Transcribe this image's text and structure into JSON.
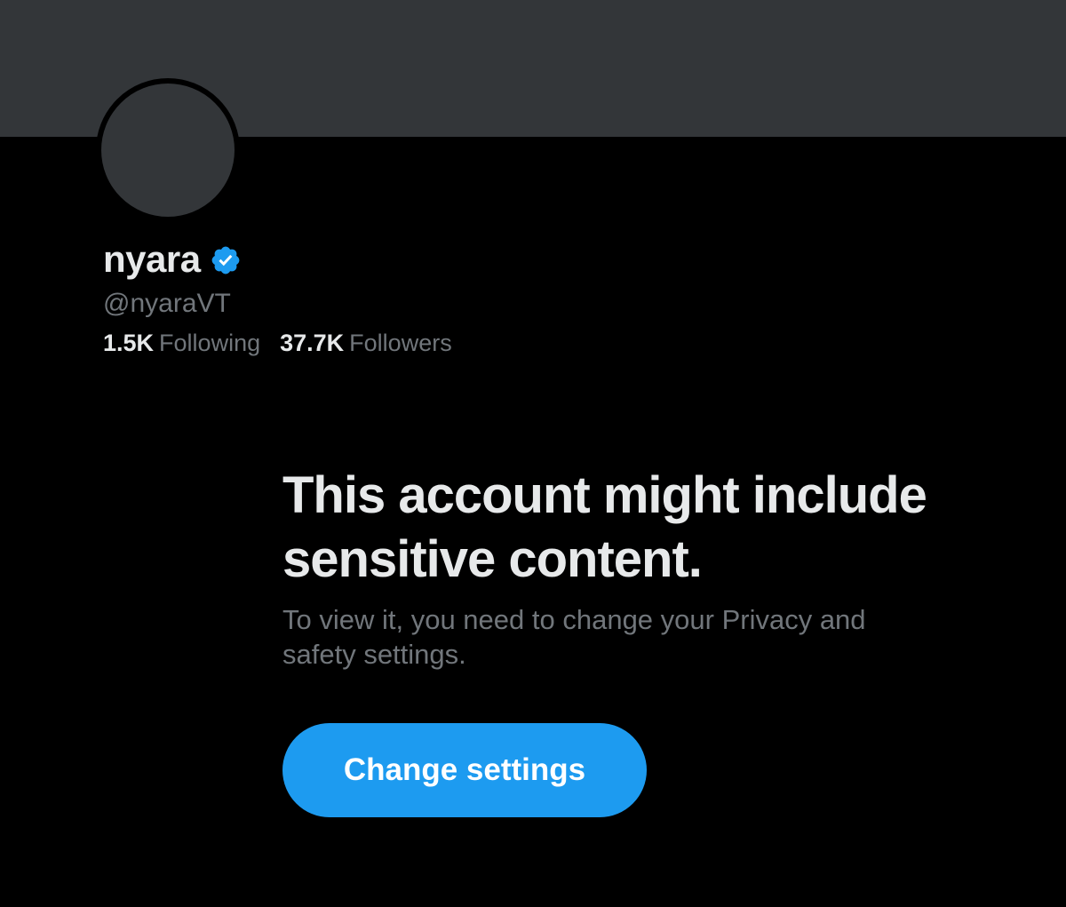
{
  "profile": {
    "display_name": "nyara",
    "handle": "@nyaraVT",
    "verified_icon": "verified-badge-icon",
    "following_count": "1.5K",
    "following_label": "Following",
    "followers_count": "37.7K",
    "followers_label": "Followers"
  },
  "notice": {
    "title": "This account might include sensitive content.",
    "body": "To view it, you need to change your Privacy and safety settings.",
    "button_label": "Change settings"
  },
  "colors": {
    "background": "#000000",
    "banner": "#333639",
    "accent": "#1d9bf0",
    "primary_text": "#e7e9ea",
    "secondary_text": "#71767b"
  }
}
